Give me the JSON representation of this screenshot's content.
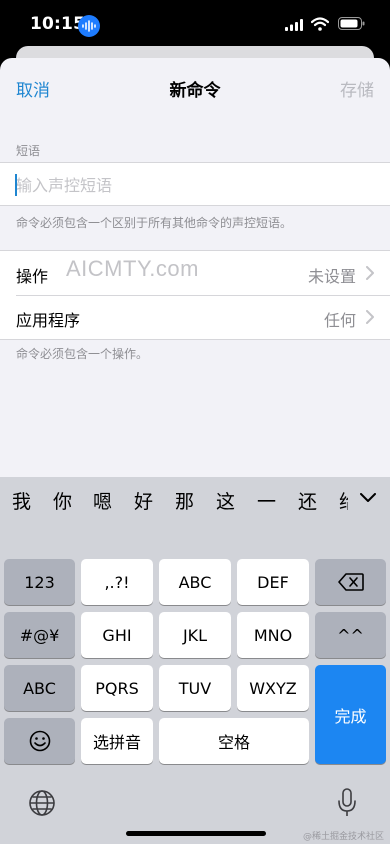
{
  "status": {
    "time": "10:15"
  },
  "nav": {
    "cancel": "取消",
    "title": "新命令",
    "save": "存储"
  },
  "phrase": {
    "section_label": "短语",
    "placeholder": "输入声控短语",
    "hint": "命令必须包含一个区别于所有其他命令的声控短语。"
  },
  "options": [
    {
      "label": "操作",
      "value": "未设置"
    },
    {
      "label": "应用程序",
      "value": "任何"
    }
  ],
  "action_hint": "命令必须包含一个操作。",
  "watermark": "AICMTY.com",
  "keyboard": {
    "candidates": [
      "我",
      "你",
      "嗯",
      "好",
      "那",
      "这",
      "一",
      "还",
      "给"
    ],
    "keys": {
      "num": "123",
      "punct": ",.?!",
      "abc1": "ABC",
      "def": "DEF",
      "symbols": "#@¥",
      "ghi": "GHI",
      "jkl": "JKL",
      "mno": "MNO",
      "caret": "^^",
      "abc2": "ABC",
      "pqrs": "PQRS",
      "tuv": "TUV",
      "wxyz": "WXYZ",
      "done": "完成",
      "pinyin": "选拼音",
      "space": "空格"
    }
  },
  "corner_mark": "@稀土掘金技术社区"
}
